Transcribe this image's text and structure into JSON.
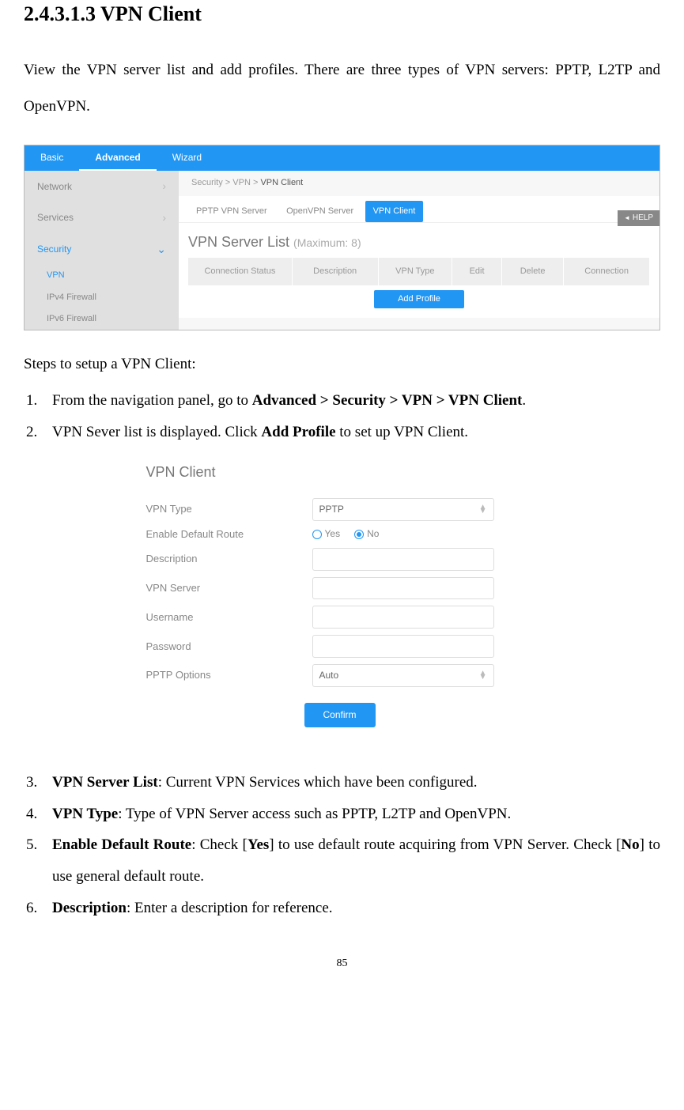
{
  "heading": "2.4.3.1.3 VPN Client",
  "intro": "View the VPN server list and add profiles. There are three types of VPN servers: PPTP, L2TP and OpenVPN.",
  "screenshot1": {
    "topbar": {
      "basic": "Basic",
      "advanced": "Advanced",
      "wizard": "Wizard"
    },
    "sidebar": {
      "network": "Network",
      "services": "Services",
      "security": "Security",
      "vpn": "VPN",
      "ipv4fw": "IPv4 Firewall",
      "ipv6fw": "IPv6 Firewall"
    },
    "breadcrumb": {
      "p1": "Security > ",
      "p2": "VPN > ",
      "active": "VPN Client"
    },
    "tabs": {
      "pptp": "PPTP VPN Server",
      "openvpn": "OpenVPN Server",
      "client": "VPN Client"
    },
    "help": "HELP",
    "list_title": "VPN Server List ",
    "list_subtitle": "(Maximum: 8)",
    "columns": {
      "c1": "Connection Status",
      "c2": "Description",
      "c3": "VPN Type",
      "c4": "Edit",
      "c5": "Delete",
      "c6": "Connection"
    },
    "add_profile": "Add Profile"
  },
  "steps_intro": "Steps to setup a VPN Client:",
  "step1_pre": "From the navigation panel, go to ",
  "step1_b": "Advanced > Security > VPN > VPN Client",
  "step1_post": ".",
  "step2_pre": "VPN Sever list is displayed. Click ",
  "step2_b": "Add Profile",
  "step2_post": " to set up VPN Client.",
  "screenshot2": {
    "title": "VPN Client",
    "labels": {
      "type": "VPN Type",
      "route": "Enable Default Route",
      "desc": "Description",
      "server": "VPN Server",
      "user": "Username",
      "pass": "Password",
      "opts": "PPTP Options"
    },
    "type_val": "PPTP",
    "yes": "Yes",
    "no": "No",
    "opts_val": "Auto",
    "confirm": "Confirm"
  },
  "desc3_b": "VPN Server List",
  "desc3_t": ": Current VPN Services which have been configured.",
  "desc4_b": "VPN Type",
  "desc4_t": ": Type of VPN Server access such as PPTP, L2TP and OpenVPN.",
  "desc5_b": "Enable Default Route",
  "desc5_t1": ": Check [",
  "desc5_b2": "Yes",
  "desc5_t2": "] to use default route acquiring from VPN Server. Check [",
  "desc5_b3": "No",
  "desc5_t3": "] to use general default route.",
  "desc6_b": "Description",
  "desc6_t": ": Enter a description for reference.",
  "page_num": "85"
}
